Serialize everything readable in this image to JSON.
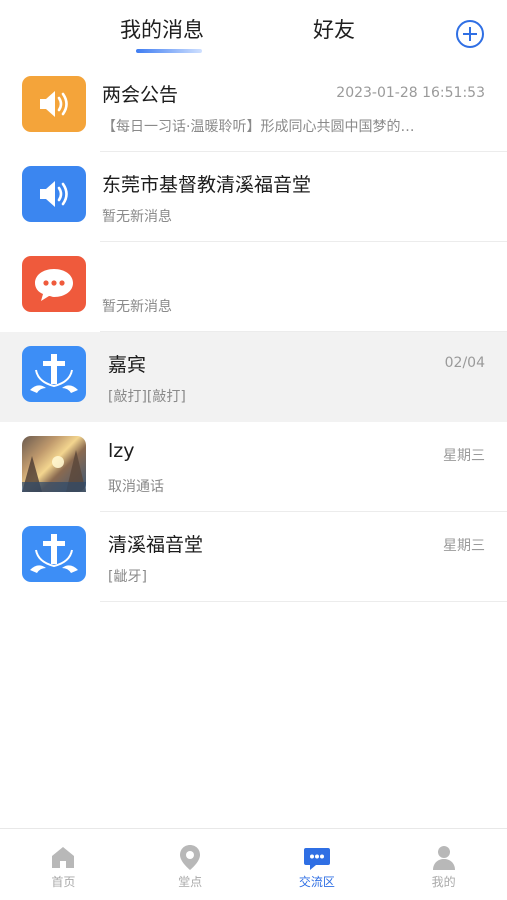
{
  "header": {
    "tabs": [
      {
        "label": "我的消息",
        "active": true
      },
      {
        "label": "好友",
        "active": false
      }
    ],
    "add_icon": "plus-circle-icon"
  },
  "conversations": [
    {
      "name": "两会公告",
      "preview": "【每日一习话·温暖聆听】形成同心共圆中国梦的…",
      "time": "2023-01-28 16:51:53",
      "avatar": "speaker-icon",
      "avatar_color": "#f4a43a"
    },
    {
      "name": "东莞市基督教清溪福音堂",
      "preview": "暂无新消息",
      "time": "",
      "avatar": "speaker-icon",
      "avatar_color": "#3b86f0"
    },
    {
      "name": "",
      "preview": "暂无新消息",
      "time": "",
      "avatar": "chat-bubble-icon",
      "avatar_color": "#ef5a3c"
    },
    {
      "name": "嘉宾",
      "preview": "[敲打][敲打]",
      "time": "02/04",
      "avatar": "cross-doves-icon",
      "avatar_color": "#3d8ef6",
      "highlighted": true
    },
    {
      "name": "lzy",
      "preview": "取消通话",
      "time": "星期三",
      "avatar": "photo-avatar"
    },
    {
      "name": "清溪福音堂",
      "preview": "[龇牙]",
      "time": "星期三",
      "avatar": "cross-doves-icon",
      "avatar_color": "#3d8ef6"
    }
  ],
  "bottom_nav": [
    {
      "label": "首页",
      "icon": "home-icon",
      "active": false
    },
    {
      "label": "堂点",
      "icon": "location-pin-icon",
      "active": false
    },
    {
      "label": "交流区",
      "icon": "chat-icon",
      "active": true
    },
    {
      "label": "我的",
      "icon": "user-icon",
      "active": false
    }
  ],
  "colors": {
    "accent": "#2f6fe4",
    "inactive": "#a9a9a9"
  }
}
